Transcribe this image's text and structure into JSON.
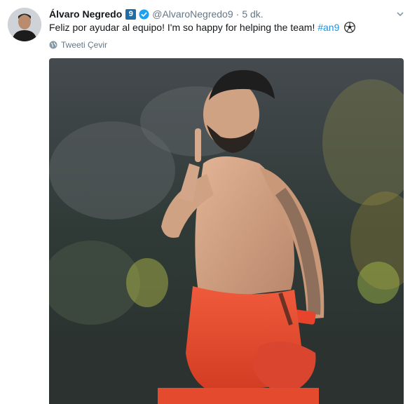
{
  "tweet": {
    "author_name": "Álvaro Negredo",
    "number_badge": "9",
    "handle": "@AlvaroNegredo9",
    "separator": "·",
    "timestamp": "5 dk.",
    "text": "Feliz por ayudar al equipo! I'm so happy for helping the team!",
    "hashtag": "#an9",
    "translate_label": "Tweeti Çevir"
  },
  "icons": {
    "verified": "verified-badge-icon",
    "more": "chevron-down-icon",
    "translate": "globe-icon",
    "emoji": "soccer-ball-icon"
  },
  "colors": {
    "accent": "#1b95e0",
    "badge": "#1f6ea8",
    "muted": "#657786",
    "jersey": "#e8432d"
  }
}
